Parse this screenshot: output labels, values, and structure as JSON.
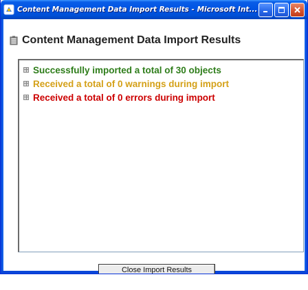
{
  "window": {
    "title": "Content Management Data Import Results - Microsoft Int...",
    "colors": {
      "titlebar": "#0054e3",
      "close_button": "#d4502b"
    }
  },
  "heading": {
    "text": "Content Management Data Import Results",
    "icon": "document-icon"
  },
  "results": [
    {
      "text": "Successfully imported a total of 30 objects",
      "color": "#2e7d1a",
      "status": "success"
    },
    {
      "text": "Received a total of 0 warnings during import",
      "color": "#d4a017",
      "status": "warning"
    },
    {
      "text": "Received a total of 0 errors during import",
      "color": "#cc0000",
      "status": "error"
    }
  ],
  "footer": {
    "close_label": "Close Import Results"
  }
}
